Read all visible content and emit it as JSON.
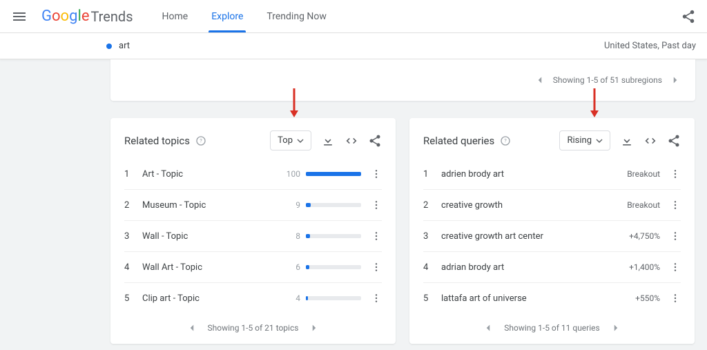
{
  "header": {
    "logo_trends": "Trends",
    "nav": {
      "home": "Home",
      "explore": "Explore",
      "trending": "Trending Now"
    }
  },
  "termbar": {
    "term": "art",
    "right": "United States, Past day"
  },
  "subregions": {
    "text": "Showing 1-5 of 51 subregions"
  },
  "topics": {
    "title": "Related topics",
    "dropdown": "Top",
    "rows": [
      {
        "rank": "1",
        "label": "Art - Topic",
        "score": "100",
        "pct": 100
      },
      {
        "rank": "2",
        "label": "Museum - Topic",
        "score": "9",
        "pct": 9
      },
      {
        "rank": "3",
        "label": "Wall - Topic",
        "score": "8",
        "pct": 8
      },
      {
        "rank": "4",
        "label": "Wall Art - Topic",
        "score": "6",
        "pct": 6
      },
      {
        "rank": "5",
        "label": "Clip art - Topic",
        "score": "4",
        "pct": 4
      }
    ],
    "footer": "Showing 1-5 of 21 topics"
  },
  "queries": {
    "title": "Related queries",
    "dropdown": "Rising",
    "rows": [
      {
        "rank": "1",
        "label": "adrien brody art",
        "delta": "Breakout"
      },
      {
        "rank": "2",
        "label": "creative growth",
        "delta": "Breakout"
      },
      {
        "rank": "3",
        "label": "creative growth art center",
        "delta": "+4,750%"
      },
      {
        "rank": "4",
        "label": "adrian brody art",
        "delta": "+1,400%"
      },
      {
        "rank": "5",
        "label": "lattafa art of universe",
        "delta": "+550%"
      }
    ],
    "footer": "Showing 1-5 of 11 queries"
  }
}
